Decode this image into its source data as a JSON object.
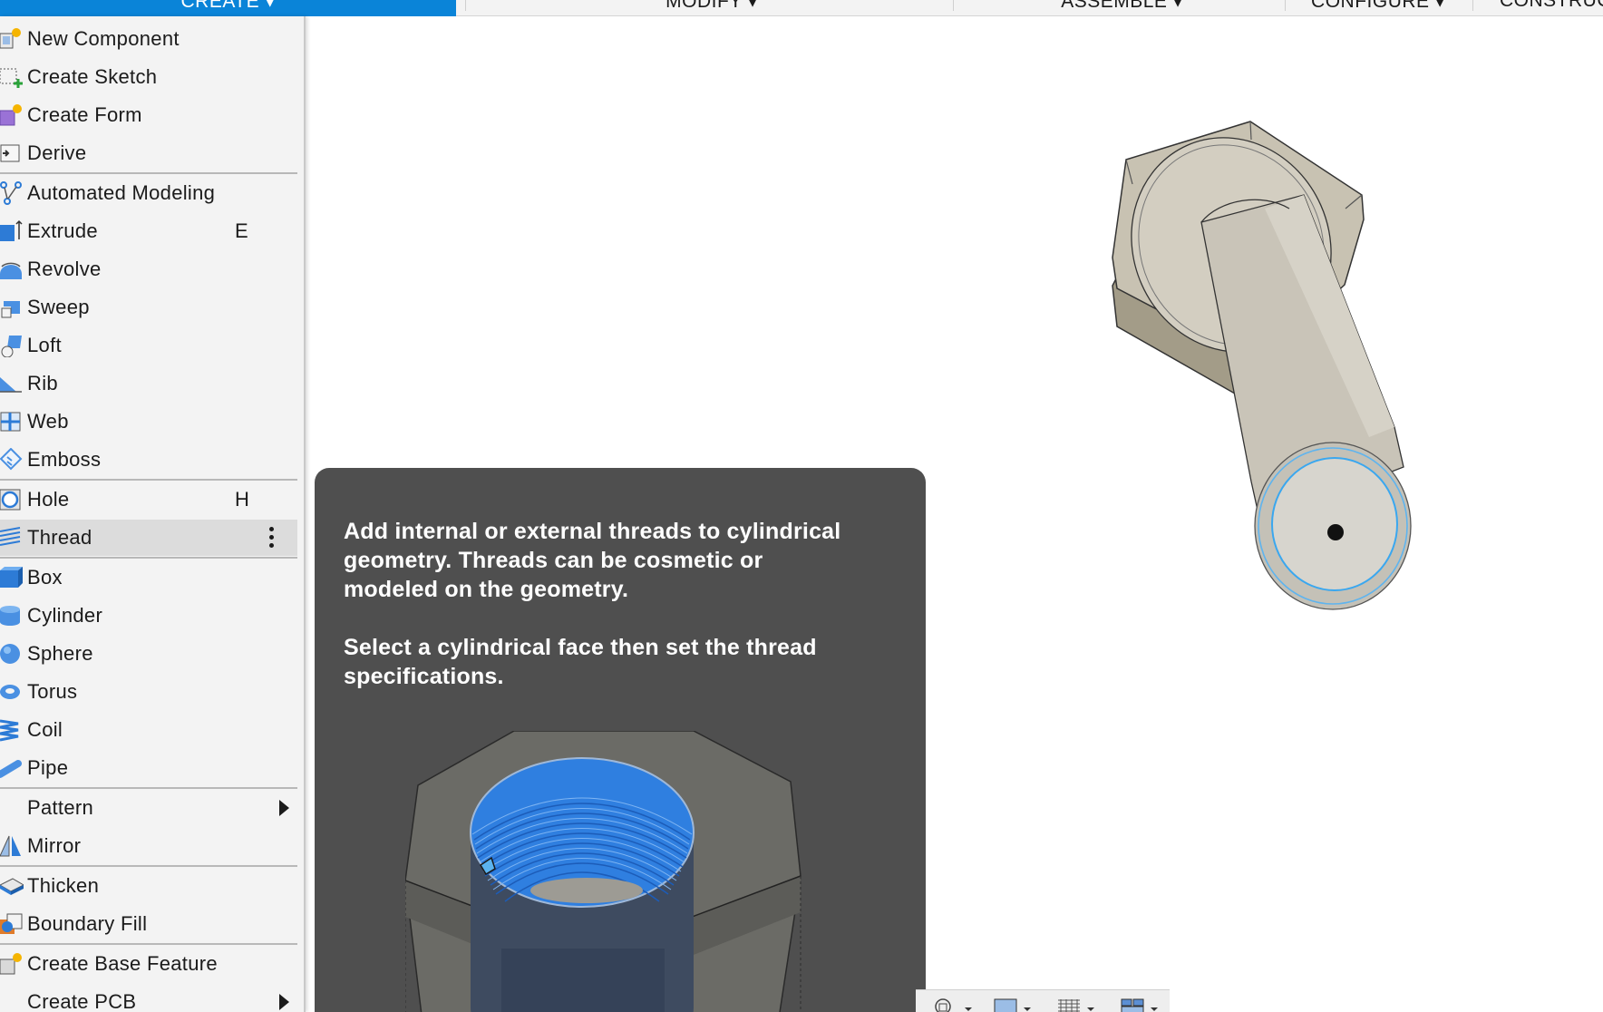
{
  "toolbar": {
    "tabs": [
      {
        "label": "CREATE ▾"
      },
      {
        "label": "MODIFY ▾"
      },
      {
        "label": "ASSEMBLE ▾"
      },
      {
        "label": "CONFIGURE ▾"
      },
      {
        "label": "CONSTRUCT"
      }
    ],
    "active_color": "#0a84d8"
  },
  "menu": {
    "items": [
      {
        "label": "New Component",
        "icon": "new-component-icon"
      },
      {
        "label": "Create Sketch",
        "icon": "create-sketch-icon"
      },
      {
        "label": "Create Form",
        "icon": "create-form-icon"
      },
      {
        "label": "Derive",
        "icon": "derive-icon"
      },
      {
        "label": "Automated Modeling",
        "icon": "automated-modeling-icon"
      },
      {
        "label": "Extrude",
        "shortcut": "E",
        "icon": "extrude-icon"
      },
      {
        "label": "Revolve",
        "icon": "revolve-icon"
      },
      {
        "label": "Sweep",
        "icon": "sweep-icon"
      },
      {
        "label": "Loft",
        "icon": "loft-icon"
      },
      {
        "label": "Rib",
        "icon": "rib-icon"
      },
      {
        "label": "Web",
        "icon": "web-icon"
      },
      {
        "label": "Emboss",
        "icon": "emboss-icon"
      },
      {
        "label": "Hole",
        "shortcut": "H",
        "icon": "hole-icon"
      },
      {
        "label": "Thread",
        "icon": "thread-icon",
        "highlighted": true
      },
      {
        "label": "Box",
        "icon": "box-icon"
      },
      {
        "label": "Cylinder",
        "icon": "cylinder-icon"
      },
      {
        "label": "Sphere",
        "icon": "sphere-icon"
      },
      {
        "label": "Torus",
        "icon": "torus-icon"
      },
      {
        "label": "Coil",
        "icon": "coil-icon"
      },
      {
        "label": "Pipe",
        "icon": "pipe-icon"
      },
      {
        "label": "Pattern",
        "submenu": true
      },
      {
        "label": "Mirror",
        "icon": "mirror-icon"
      },
      {
        "label": "Thicken",
        "icon": "thicken-icon"
      },
      {
        "label": "Boundary Fill",
        "icon": "boundary-fill-icon"
      },
      {
        "label": "Create Base Feature",
        "icon": "create-base-feature-icon"
      },
      {
        "label": "Create PCB",
        "submenu": true
      }
    ]
  },
  "tooltip": {
    "line1": "Add internal or external threads to cylindrical",
    "line2": "geometry. Threads can be cosmetic or",
    "line3": "modeled on the geometry.",
    "line4": "Select a cylindrical face then set the thread",
    "line5": "specifications."
  },
  "colors": {
    "tooltip_bg": "#4f4f4f",
    "thread_blue": "#2f7fe0",
    "bolt_body": "#cdc9bf"
  }
}
